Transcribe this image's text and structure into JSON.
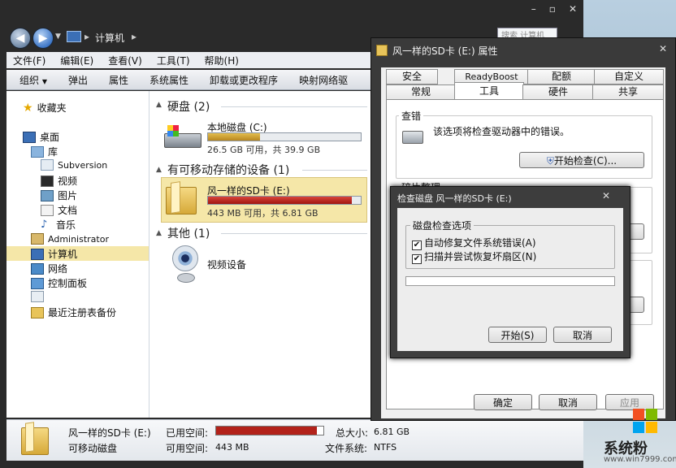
{
  "explorer": {
    "address": "计算机",
    "menu": [
      "文件(F)",
      "编辑(E)",
      "查看(V)",
      "工具(T)",
      "帮助(H)"
    ],
    "toolbar": [
      "组织",
      "弹出",
      "属性",
      "系统属性",
      "卸载或更改程序",
      "映射网络驱"
    ],
    "nav": {
      "favorites": "收藏夹",
      "desktop": "桌面",
      "library": "库",
      "subversion": "Subversion",
      "video": "视频",
      "pictures": "图片",
      "documents": "文档",
      "music": "音乐",
      "admin": "Administrator",
      "computer": "计算机",
      "network": "网络",
      "control_panel": "控制面板",
      "registry_backup": "最近注册表备份"
    },
    "groups": {
      "hdd": "硬盘 (2)",
      "removable": "有可移动存储的设备 (1)",
      "other": "其他 (1)"
    },
    "drives": {
      "local": {
        "name": "本地磁盘 (C:)",
        "info": "26.5 GB 可用，共 39.9 GB",
        "used_fraction": 0.34
      },
      "sd": {
        "name": "风一样的SD卡 (E:)",
        "info": "443 MB 可用，共 6.81 GB",
        "used_fraction": 0.94
      },
      "video": {
        "name": "视频设备"
      }
    },
    "details": {
      "name": "风一样的SD卡 (E:)",
      "type": "可移动磁盘",
      "used_label": "已用空间:",
      "free_label": "可用空间:",
      "free_value": "443 MB",
      "total_label": "总大小:",
      "total_value": "6.81 GB",
      "fs_label": "文件系统:",
      "fs_value": "NTFS",
      "used_fraction": 0.94
    }
  },
  "properties": {
    "title": "风一样的SD卡 (E:) 属性",
    "tabs_row1": [
      "安全",
      "ReadyBoost",
      "配额",
      "自定义"
    ],
    "tabs_row2": [
      "常规",
      "工具",
      "硬件",
      "共享"
    ],
    "error_group": "查错",
    "error_text": "该选项将检查驱动器中的错误。",
    "check_button": "开始检查(C)...",
    "defrag_group": "碎片整理",
    "ok": "确定",
    "cancel": "取消",
    "apply": "应用"
  },
  "checkdisk": {
    "title": "检查磁盘 风一样的SD卡 (E:)",
    "group": "磁盘检查选项",
    "opt1": "自动修复文件系统错误(A)",
    "opt2": "扫描并尝试恢复坏扇区(N)",
    "start": "开始(S)",
    "cancel": "取消",
    "progress": 0
  },
  "desktop": {
    "search_partial": "搜索 计算机"
  },
  "watermark": {
    "name": "系统粉",
    "url": "www.win7999.com"
  },
  "colors": {
    "selection": "#f5e7a8",
    "disk_ok": "#c79a2e",
    "disk_full": "#b3221a"
  }
}
